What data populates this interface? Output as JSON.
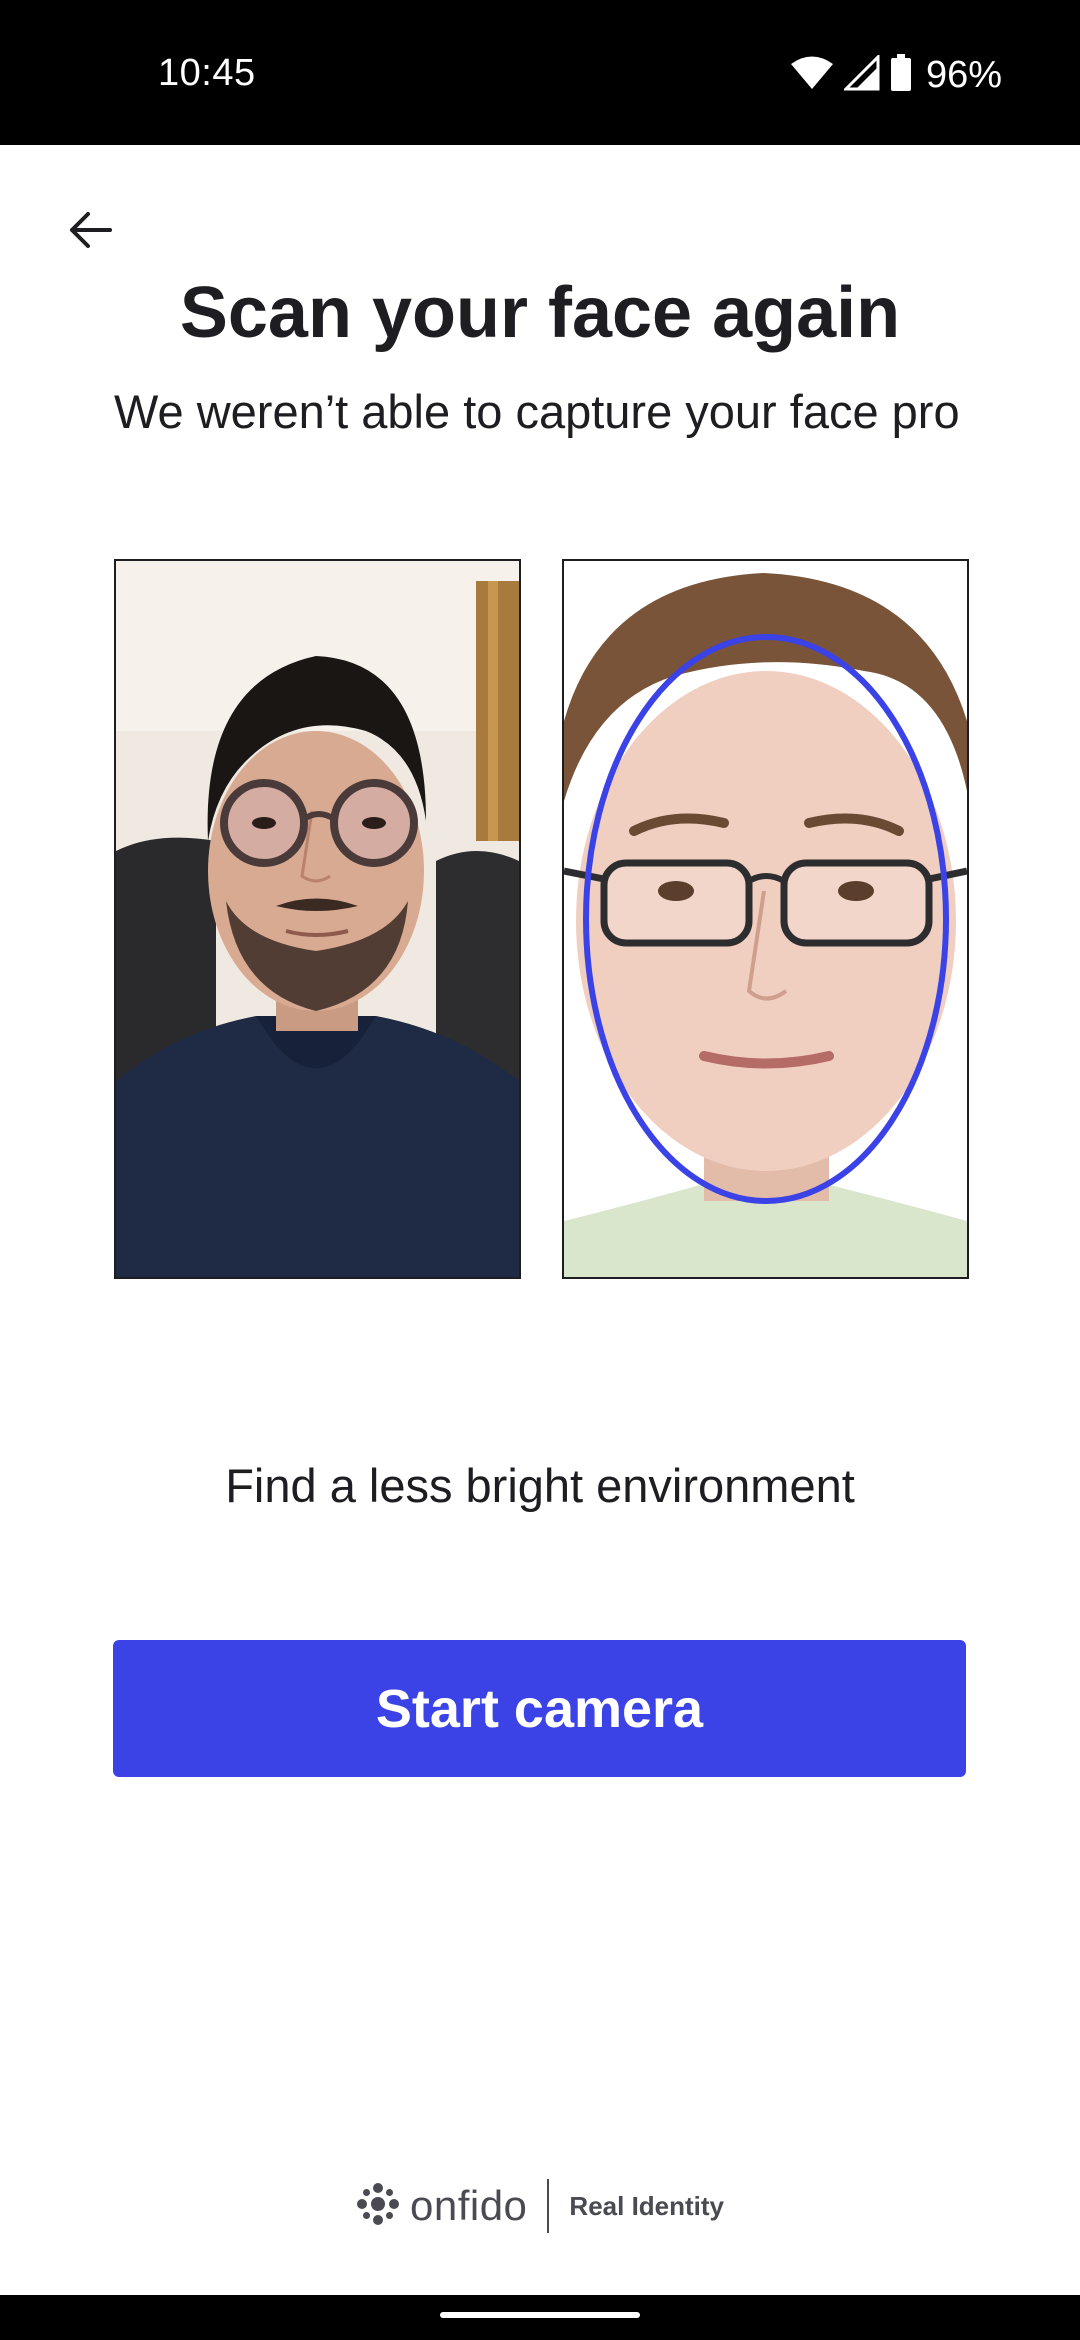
{
  "status_bar": {
    "time": "10:45",
    "battery": "96%"
  },
  "header": {
    "back_icon": "arrow-left-icon"
  },
  "main": {
    "title": "Scan your face again",
    "subtitle": "We weren’t able to capture your face pro",
    "hint": "Find a less bright environment",
    "primary_button_label": "Start camera"
  },
  "footer": {
    "brand_name": "onfido",
    "tagline": "Real Identity"
  },
  "colors": {
    "accent": "#3b43e6",
    "text": "#1d1d22",
    "status_bar": "#000000"
  }
}
